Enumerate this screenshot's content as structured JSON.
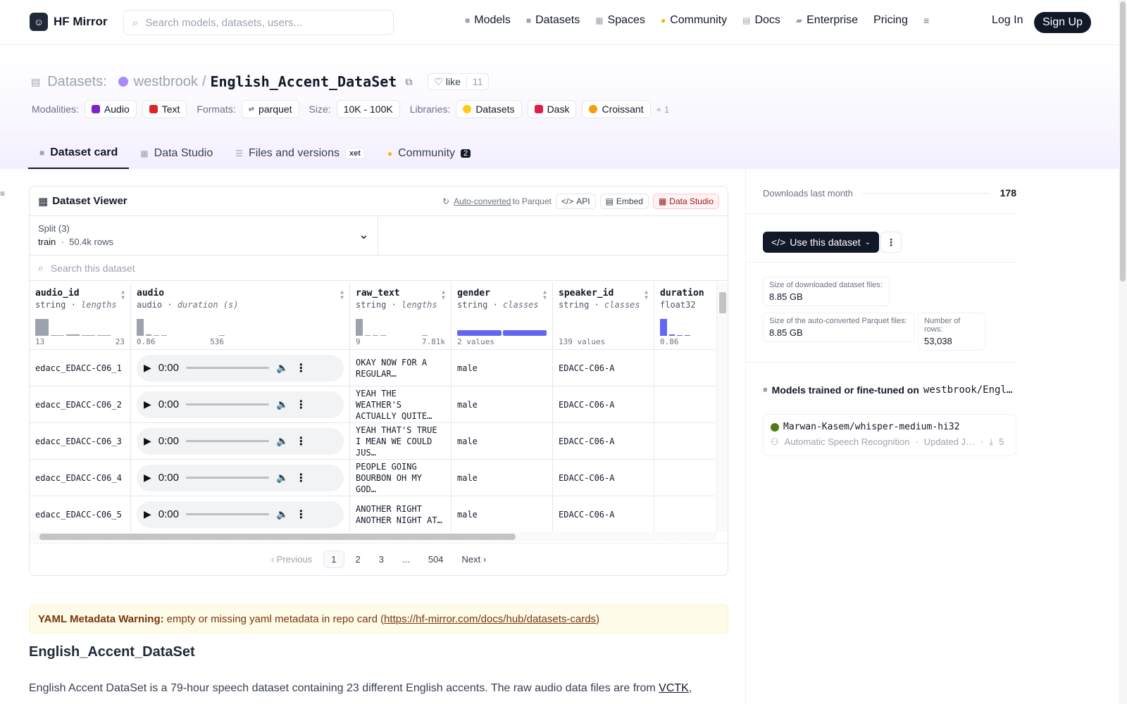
{
  "app": {
    "brand": "HF Mirror",
    "search_placeholder": "Search models, datasets, users...",
    "nav": [
      {
        "label": "Models",
        "icon": "cube-icon"
      },
      {
        "label": "Datasets",
        "icon": "database-icon"
      },
      {
        "label": "Spaces",
        "icon": "grid-icon"
      },
      {
        "label": "Community",
        "icon": "smiley-icon"
      },
      {
        "label": "Docs",
        "icon": "book-icon"
      },
      {
        "label": "Enterprise",
        "icon": "building-icon"
      },
      {
        "label": "Pricing"
      }
    ],
    "login": "Log In",
    "signup": "Sign Up"
  },
  "repo": {
    "section": "Datasets:",
    "owner": "westbrook",
    "name": "English_Accent_DataSet",
    "like_label": "like",
    "likes": "11",
    "modalities_label": "Modalities:",
    "modalities": [
      "Audio",
      "Text"
    ],
    "formats_label": "Formats:",
    "format": "parquet",
    "size_label": "Size:",
    "size": "10K - 100K",
    "libraries_label": "Libraries:",
    "libraries": [
      "Datasets",
      "Dask",
      "Croissant"
    ],
    "libraries_more": "+ 1"
  },
  "tabs": [
    {
      "label": "Dataset card"
    },
    {
      "label": "Data Studio"
    },
    {
      "label": "Files and versions",
      "badge": "xet"
    },
    {
      "label": "Community",
      "count": "2"
    }
  ],
  "viewer": {
    "title": "Dataset Viewer",
    "auto_converted": "Auto-converted",
    "to_parquet": " to Parquet",
    "api": "API",
    "embed": "Embed",
    "data_studio": "Data Studio",
    "split_label": "Split (3)",
    "split_value": "train",
    "split_rows": "50.4k rows",
    "search_placeholder": "Search this dataset",
    "columns": [
      {
        "name": "audio_id",
        "type": "string",
        "stat": "lengths",
        "min": "13",
        "max": "23"
      },
      {
        "name": "audio",
        "type": "audio",
        "stat": "duration (s)",
        "min": "0.86",
        "max": "536"
      },
      {
        "name": "raw_text",
        "type": "string",
        "stat": "lengths",
        "min": "9",
        "max": "7.81k"
      },
      {
        "name": "gender",
        "type": "string",
        "stat": "classes",
        "min": "2 values",
        "max": ""
      },
      {
        "name": "speaker_id",
        "type": "string",
        "stat": "classes",
        "min": "139 values",
        "max": ""
      },
      {
        "name": "duration",
        "type": "float32",
        "stat": "",
        "min": "0.86",
        "max": ""
      }
    ],
    "rows": [
      {
        "audio_id": "edacc_EDACC-C06_1",
        "time": "0:00",
        "raw_text": "OKAY NOW FOR A REGULAR…",
        "gender": "male",
        "speaker_id": "EDACC-C06-A"
      },
      {
        "audio_id": "edacc_EDACC-C06_2",
        "time": "0:00",
        "raw_text": "YEAH THE WEATHER'S ACTUALLY QUITE…",
        "gender": "male",
        "speaker_id": "EDACC-C06-A"
      },
      {
        "audio_id": "edacc_EDACC-C06_3",
        "time": "0:00",
        "raw_text": "YEAH THAT'S TRUE I MEAN WE COULD JUS…",
        "gender": "male",
        "speaker_id": "EDACC-C06-A"
      },
      {
        "audio_id": "edacc_EDACC-C06_4",
        "time": "0:00",
        "raw_text": "PEOPLE GOING BOURBON OH MY GOD…",
        "gender": "male",
        "speaker_id": "EDACC-C06-A"
      },
      {
        "audio_id": "edacc_EDACC-C06_5",
        "time": "0:00",
        "raw_text": "ANOTHER RIGHT ANOTHER NIGHT AT…",
        "gender": "male",
        "speaker_id": "EDACC-C06-A"
      }
    ],
    "pager": {
      "prev": "Previous",
      "pages": [
        "1",
        "2",
        "3",
        "...",
        "504"
      ],
      "next": "Next"
    }
  },
  "warning": {
    "title": "YAML Metadata Warning:",
    "text": "empty or missing yaml metadata in repo card (",
    "link": "https://hf-mirror.com/docs/hub/datasets-cards",
    "close": ")"
  },
  "readme": {
    "heading": "English_Accent_DataSet",
    "para": "English Accent DataSet is a 79-hour speech dataset containing 23 different English accents. The raw audio data files are from ",
    "link": "VCTK",
    "after": ","
  },
  "sidebar": {
    "downloads_label": "Downloads last month",
    "downloads": "178",
    "use_label": "Use this dataset",
    "dl_size_label": "Size of downloaded dataset files:",
    "dl_size": "8.85 GB",
    "pq_size_label": "Size of the auto-converted Parquet files:",
    "pq_size": "8.85 GB",
    "rows_label": "Number of rows:",
    "rows": "53,038",
    "models_label": "Models trained or fine-tuned on",
    "models_repo": "westbrook/Engl…",
    "model_name": "Marwan-Kasem/whisper-medium-hi32",
    "model_task": "Automatic Speech Recognition",
    "model_updated": "Updated J…",
    "model_downloads": "5"
  },
  "colors": {
    "accent": "#6366f1",
    "brand_dark": "#111827"
  }
}
